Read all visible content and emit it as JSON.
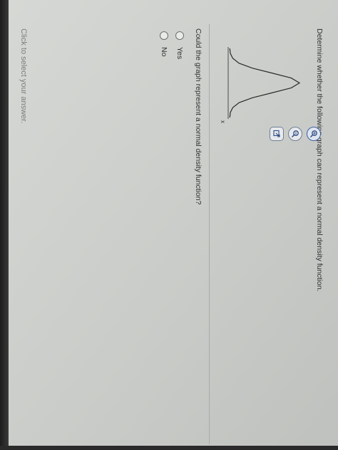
{
  "question": {
    "instruction": "Determine whether the following graph can represent a normal density function.",
    "prompt": "Could the graph represent a normal density function?",
    "hint": "Click to select your answer."
  },
  "chart_data": {
    "type": "line",
    "xlabel": "x",
    "ylabel": "",
    "title": "",
    "x": [
      -3.5,
      -3,
      -2.5,
      -2,
      -1.5,
      -1,
      -0.5,
      0,
      0.5,
      1,
      1.5,
      2,
      2.5,
      3,
      3.5
    ],
    "y": [
      0.001,
      0.004,
      0.018,
      0.054,
      0.13,
      0.242,
      0.352,
      0.399,
      0.352,
      0.242,
      0.13,
      0.054,
      0.018,
      0.004,
      0.001
    ]
  },
  "tools": [
    {
      "icon": "zoom-in-icon"
    },
    {
      "icon": "zoom-out-icon"
    },
    {
      "icon": "popout-icon"
    }
  ],
  "options": [
    {
      "label": "Yes"
    },
    {
      "label": "No"
    }
  ],
  "colors": {
    "curve": "#2a2a2a",
    "tool_border": "#3d5fa0"
  }
}
